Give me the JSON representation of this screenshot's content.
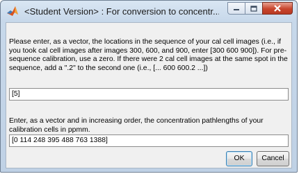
{
  "window": {
    "title": "<Student Version> : For conversion to concentr...",
    "controls": {
      "minimize": "minimize",
      "maximize": "maximize",
      "close": "close"
    }
  },
  "dialog": {
    "prompt1": "Please enter, as a vector, the locations in the sequence of your cal cell images (i.e., if you took cal cell images after images 300, 600, and 900, enter [300 600 900]).  For pre-sequence calibration, use a zero.  If there were 2 cal cell images at the same spot in the sequence, add a \".2\" to the second one (i.e., [... 600 600.2 ...])",
    "input1_value": "[5]",
    "prompt2": "Enter, as a vector and in increasing order, the concentration pathlengths of your calibration cells in ppmm.",
    "input2_value": "[0 114 248 395 488 763 1388]",
    "ok_label": "OK",
    "cancel_label": "Cancel"
  },
  "colors": {
    "close_button": "#c8452d",
    "titlebar": "#c7d8ea",
    "dialog_bg": "#f0f0f0"
  },
  "icons": {
    "app": "matlab-icon",
    "minimize": "minimize-icon",
    "maximize": "maximize-icon",
    "close": "close-icon"
  }
}
